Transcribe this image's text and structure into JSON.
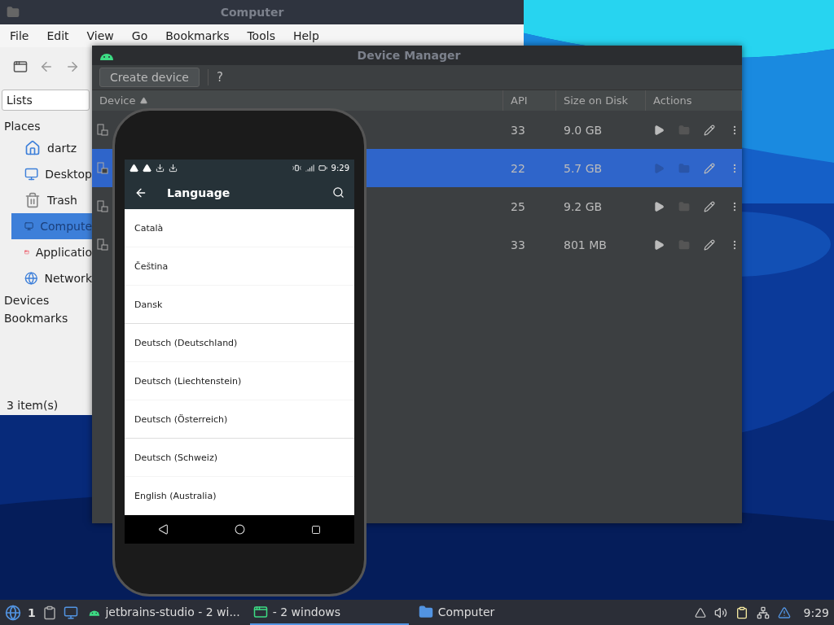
{
  "file_manager": {
    "title": "Computer",
    "menu": [
      "File",
      "Edit",
      "View",
      "Go",
      "Bookmarks",
      "Tools",
      "Help"
    ],
    "list_mode": "Lists",
    "places_heading": "Places",
    "places": [
      {
        "label": "dartz",
        "kind": "home",
        "selected": false
      },
      {
        "label": "Desktop",
        "kind": "desktop",
        "selected": false
      },
      {
        "label": "Trash",
        "kind": "trash",
        "selected": false
      },
      {
        "label": "Compute",
        "kind": "computer",
        "selected": true
      },
      {
        "label": "Applicatio",
        "kind": "apps",
        "selected": false
      },
      {
        "label": "Network",
        "kind": "network",
        "selected": false
      }
    ],
    "sections": [
      "Devices",
      "Bookmarks"
    ],
    "status": "3 item(s)"
  },
  "device_manager": {
    "title": "Device Manager",
    "create_button": "Create device",
    "help_button": "?",
    "columns": [
      {
        "label": "Device",
        "sorted": true
      },
      {
        "label": "API",
        "sorted": false
      },
      {
        "label": "Size on Disk",
        "sorted": false
      },
      {
        "label": "Actions",
        "sorted": false
      }
    ],
    "rows": [
      {
        "api": "33",
        "size": "9.0 GB",
        "selected": false
      },
      {
        "api": "22",
        "size": "5.7 GB",
        "selected": true
      },
      {
        "api": "25",
        "size": "9.2 GB",
        "selected": false
      },
      {
        "api": "33",
        "size": "801 MB",
        "selected": false
      }
    ]
  },
  "emulator": {
    "time": "9:29",
    "title": "Language",
    "languages": [
      {
        "label": "Català",
        "group_end": false
      },
      {
        "label": "Čeština",
        "group_end": false
      },
      {
        "label": "Dansk",
        "group_end": true
      },
      {
        "label": "Deutsch (Deutschland)",
        "group_end": false
      },
      {
        "label": "Deutsch (Liechtenstein)",
        "group_end": false
      },
      {
        "label": "Deutsch (Österreich)",
        "group_end": true
      },
      {
        "label": "Deutsch (Schweiz)",
        "group_end": false
      },
      {
        "label": "English (Australia)",
        "group_end": false
      }
    ]
  },
  "taskbar": {
    "workspace": "1",
    "tasks": [
      {
        "label": "jetbrains-studio - 2 wi...",
        "kind": "android",
        "selected": false
      },
      {
        "label": "- 2 windows",
        "kind": "studio",
        "selected": true
      },
      {
        "label": "Computer",
        "kind": "folder",
        "selected": false
      }
    ],
    "clock": "9:29"
  }
}
